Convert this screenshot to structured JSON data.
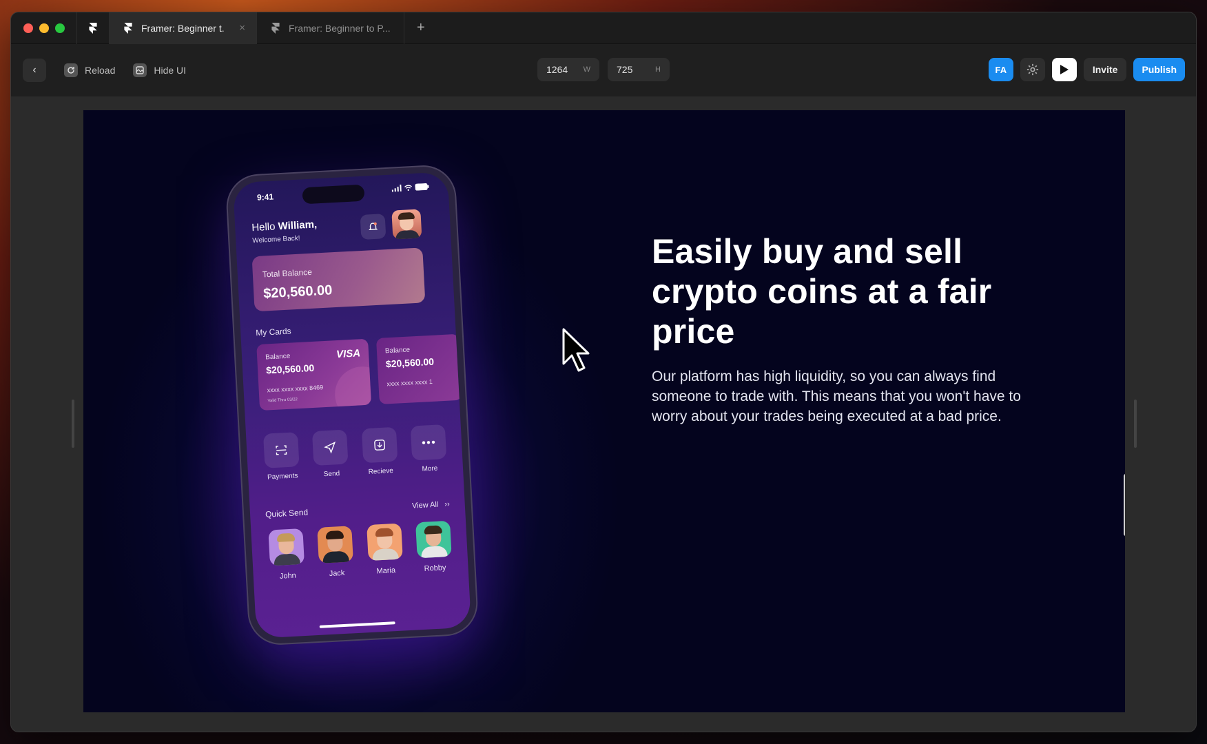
{
  "tabs": [
    {
      "title": "Framer: Beginner t.",
      "close": "×"
    },
    {
      "title": "Framer: Beginner to P..."
    }
  ],
  "new_tab": "+",
  "toolbar": {
    "back": "‹",
    "reload_label": "Reload",
    "hide_ui_label": "Hide UI",
    "width_value": "1264",
    "width_unit": "W",
    "height_value": "725",
    "height_unit": "H",
    "user_initials": "FA",
    "invite_label": "Invite",
    "publish_label": "Publish"
  },
  "hero": {
    "headline": "Easily buy and sell crypto coins at a fair price",
    "paragraph": "Our platform has high liquidity, so you can always find someone to trade with. This means that you won't have to worry about your trades being executed at a bad price."
  },
  "phone": {
    "time": "9:41",
    "greeting_prefix": "Hello ",
    "greeting_name": "William,",
    "welcome": "Welcome Back!",
    "total_balance_label": "Total Balance",
    "total_balance": "$20,560.00",
    "my_cards_label": "My Cards",
    "cards": [
      {
        "label": "Balance",
        "amount": "$20,560.00",
        "number": "xxxx xxxx xxxx 8469",
        "valid": "Valid Thru    03/22",
        "brand": "VISA"
      },
      {
        "label": "Balance",
        "amount": "$20,560.00",
        "number": "xxxx xxxx xxxx 1"
      }
    ],
    "actions": [
      {
        "label": "Payments",
        "icon": "payments-icon"
      },
      {
        "label": "Send",
        "icon": "send-icon"
      },
      {
        "label": "Recieve",
        "icon": "receive-icon"
      },
      {
        "label": "More",
        "icon": "more-icon"
      }
    ],
    "quick_send_label": "Quick Send",
    "view_all_label": "View All",
    "people": [
      {
        "name": "John"
      },
      {
        "name": "Jack"
      },
      {
        "name": "Maria"
      },
      {
        "name": "Robby"
      }
    ]
  },
  "colors": {
    "accent_blue": "#1a8cf0",
    "preview_bg": "#04041e"
  }
}
